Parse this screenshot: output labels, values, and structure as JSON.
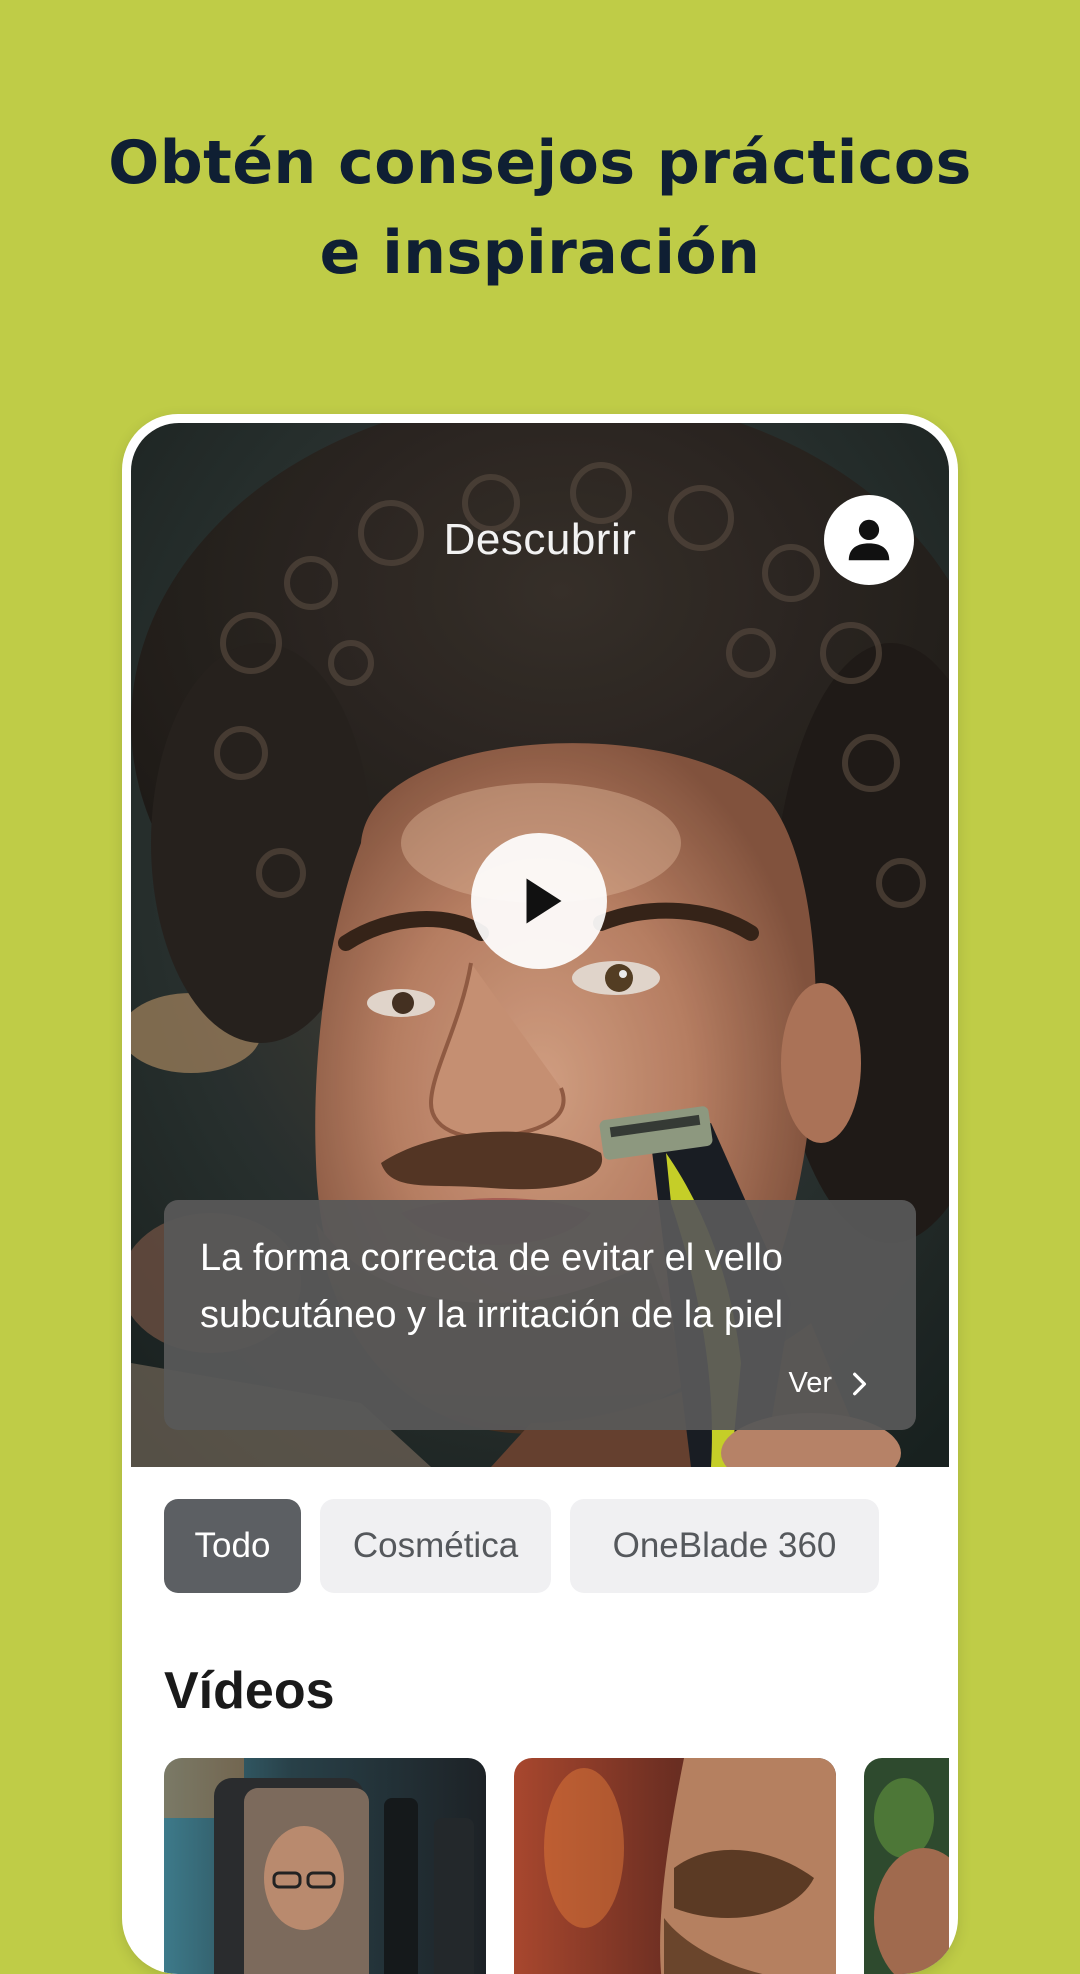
{
  "headline": "Obtén consejos prácticos e inspiración",
  "screen": {
    "title": "Descubrir",
    "profile_icon": "person-icon",
    "play_icon": "play-icon",
    "featured": {
      "caption": "La forma correcta de evitar el vello subcutáneo y la irritación de la piel",
      "link_label": "Ver",
      "link_icon": "chevron-right-icon"
    },
    "filters": [
      {
        "label": "Todo",
        "selected": true
      },
      {
        "label": "Cosmética",
        "selected": false
      },
      {
        "label": "OneBlade 360",
        "selected": false
      }
    ],
    "section_title": "Vídeos"
  },
  "colors": {
    "background": "#bfcc47",
    "headline": "#0f1f33",
    "chip_active": "#5c5f63",
    "chip_inactive": "#f0f0f2"
  }
}
